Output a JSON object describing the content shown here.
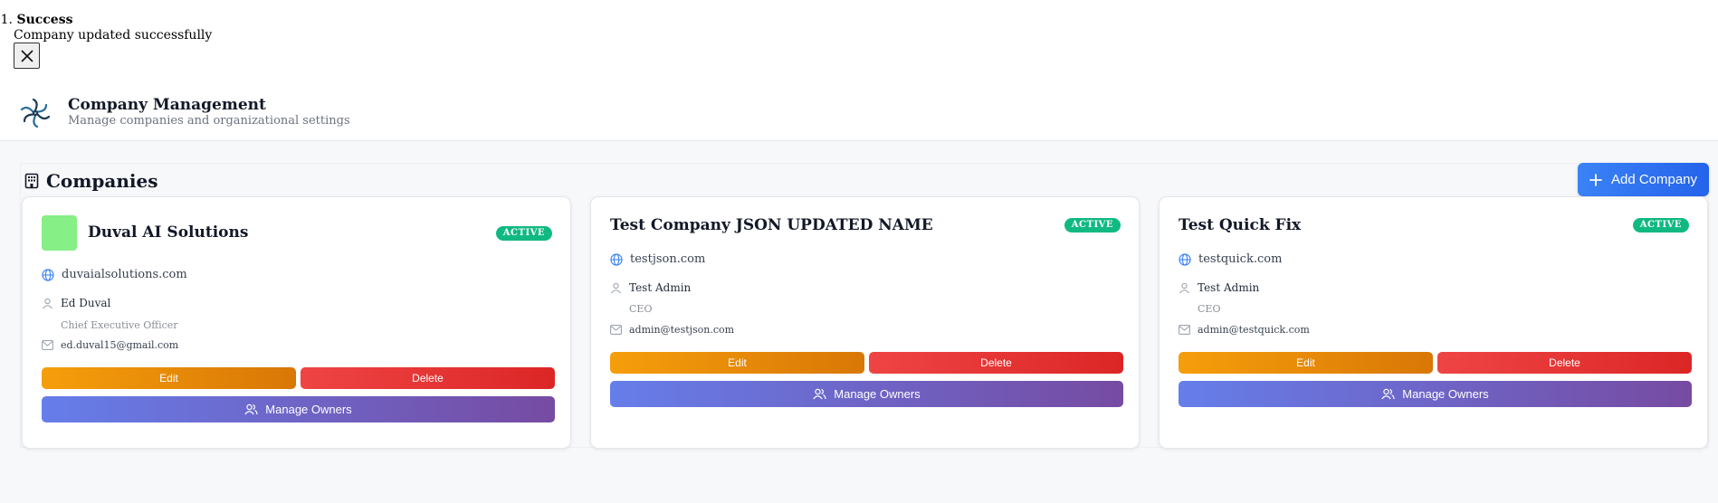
{
  "toast": {
    "number": "1.",
    "title": "Success",
    "message": "Company updated successfully"
  },
  "header": {
    "title": "Company Management",
    "subtitle": "Manage companies and organizational settings"
  },
  "section": {
    "title": "Companies",
    "add_button": "Add Company"
  },
  "companies": [
    {
      "name": "Duval AI Solutions",
      "status": "ACTIVE",
      "website": "duvaialsolutions.com",
      "owner_name": "Ed Duval",
      "owner_title": "Chief Executive Officer",
      "email": "ed.duval15@gmail.com",
      "edit_label": "Edit",
      "delete_label": "Delete",
      "owners_label": "Manage Owners",
      "logo_color": "#86ef86"
    },
    {
      "name": "Test Company JSON UPDATED NAME",
      "status": "ACTIVE",
      "website": "testjson.com",
      "owner_name": "Test Admin",
      "owner_title": "CEO",
      "email": "admin@testjson.com",
      "edit_label": "Edit",
      "delete_label": "Delete",
      "owners_label": "Manage Owners"
    },
    {
      "name": "Test Quick Fix",
      "status": "ACTIVE",
      "website": "testquick.com",
      "owner_name": "Test Admin",
      "owner_title": "CEO",
      "email": "admin@testquick.com",
      "edit_label": "Edit",
      "delete_label": "Delete",
      "owners_label": "Manage Owners"
    }
  ],
  "colors": {
    "active_badge": "#10b981",
    "edit": "#f59e0b",
    "delete": "#ef4444",
    "owners_start": "#667eea",
    "owners_end": "#764ba2",
    "primary": "#2563eb"
  }
}
